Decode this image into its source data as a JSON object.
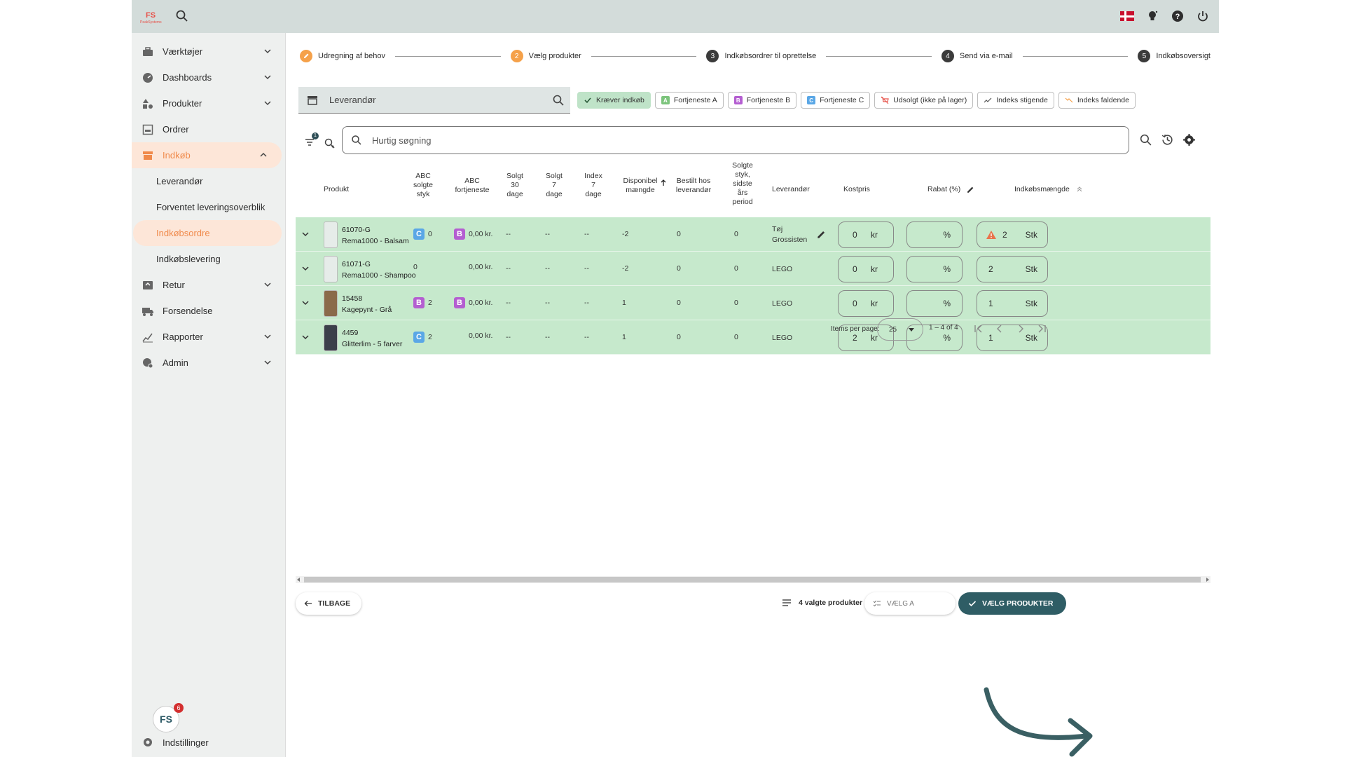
{
  "sidebar": {
    "items": [
      {
        "label": "Værktøjer",
        "icon": "toolbox-icon",
        "expandable": true
      },
      {
        "label": "Dashboards",
        "icon": "dashboard-icon",
        "expandable": true
      },
      {
        "label": "Produkter",
        "icon": "shapes-icon",
        "expandable": true
      },
      {
        "label": "Ordrer",
        "icon": "inbox-icon",
        "expandable": false
      },
      {
        "label": "Indkøb",
        "icon": "store-icon",
        "expandable": true,
        "active": true
      }
    ],
    "subitems": [
      {
        "label": "Leverandør"
      },
      {
        "label": "Forventet leveringsoverblik"
      },
      {
        "label": "Indkøbsordre",
        "active": true
      },
      {
        "label": "Indkøbslevering"
      }
    ],
    "items_after": [
      {
        "label": "Retur",
        "icon": "return-icon",
        "expandable": true
      },
      {
        "label": "Forsendelse",
        "icon": "truck-icon",
        "expandable": false
      },
      {
        "label": "Rapporter",
        "icon": "report-icon",
        "expandable": true
      },
      {
        "label": "Admin",
        "icon": "admin-icon",
        "expandable": true
      }
    ],
    "notification_count": "6",
    "settings_label": "Indstillinger"
  },
  "stepper": [
    {
      "num": "",
      "label": "Udregning af behov",
      "state": "done"
    },
    {
      "num": "2",
      "label": "Vælg produkter",
      "state": "current"
    },
    {
      "num": "3",
      "label": "Indkøbsordrer til oprettelse",
      "state": "todo"
    },
    {
      "num": "4",
      "label": "Send via e-mail",
      "state": "todo"
    },
    {
      "num": "5",
      "label": "Indkøbsoversigt",
      "state": "todo"
    }
  ],
  "vendor_field": {
    "label": "Leverandør"
  },
  "chips": [
    {
      "label": "Kræver indkøb",
      "selected": true,
      "icon": "check"
    },
    {
      "label": "Fortjeneste A",
      "selected": false,
      "icon": "A",
      "color": "#7cc47c"
    },
    {
      "label": "Fortjeneste B",
      "selected": false,
      "icon": "B",
      "color": "#b45ed1"
    },
    {
      "label": "Fortjeneste C",
      "selected": false,
      "icon": "C",
      "color": "#5aa7e6"
    },
    {
      "label": "Udsolgt (ikke på lager)",
      "selected": false,
      "icon": "cart"
    },
    {
      "label": "Indeks stigende",
      "selected": false,
      "icon": "trend-up"
    },
    {
      "label": "Indeks faldende",
      "selected": false,
      "icon": "trend-down"
    }
  ],
  "quick_search": {
    "placeholder": "Hurtig søgning",
    "filter_count": "1"
  },
  "columns": {
    "product": "Produkt",
    "abc_units": [
      "ABC",
      "solgte",
      "styk"
    ],
    "abc_profit": [
      "ABC",
      "fortjeneste"
    ],
    "sold30": [
      "Solgt",
      "30",
      "dage"
    ],
    "sold7": [
      "Solgt",
      "7",
      "dage"
    ],
    "index7": [
      "Index",
      "7",
      "dage"
    ],
    "available": [
      "Disponibel",
      "mængde"
    ],
    "ordered": [
      "Bestilt hos",
      "leverandør"
    ],
    "sold_last_year": [
      "Solgte",
      "styk,",
      "sidste",
      "års",
      "period"
    ],
    "supplier": "Leverandør",
    "cost": "Kostpris",
    "discount": "Rabat (%)",
    "qty": "Indkøbsmængde"
  },
  "rows": [
    {
      "sku": "61070-G",
      "name": "Rema1000 - Balsam",
      "abc_units_badge": "C",
      "abc_units": "0",
      "abc_profit_badge": "B",
      "abc_profit": "0,00 kr.",
      "sold30": "--",
      "sold7": "--",
      "index7": "--",
      "available": "-2",
      "ordered": "0",
      "sold_last_year": "0",
      "supplier": [
        "Tøj",
        "Grossisten"
      ],
      "supplier_editable": true,
      "cost": "0",
      "cost_unit": "kr",
      "discount": "",
      "discount_unit": "%",
      "qty": "2",
      "qty_unit": "Stk",
      "warning": true
    },
    {
      "sku": "61071-G",
      "name": "Rema1000 - Shampoo",
      "abc_units_badge": "",
      "abc_units": "0",
      "abc_profit_badge": "",
      "abc_profit": "0,00 kr.",
      "sold30": "--",
      "sold7": "--",
      "index7": "--",
      "available": "-2",
      "ordered": "0",
      "sold_last_year": "0",
      "supplier": [
        "LEGO"
      ],
      "supplier_editable": false,
      "cost": "0",
      "cost_unit": "kr",
      "discount": "",
      "discount_unit": "%",
      "qty": "2",
      "qty_unit": "Stk",
      "warning": false
    },
    {
      "sku": "15458",
      "name": "Kagepynt - Grå",
      "abc_units_badge": "B",
      "abc_units": "2",
      "abc_profit_badge": "B",
      "abc_profit": "0,00 kr.",
      "sold30": "--",
      "sold7": "--",
      "index7": "--",
      "available": "1",
      "ordered": "0",
      "sold_last_year": "0",
      "supplier": [
        "LEGO"
      ],
      "supplier_editable": false,
      "cost": "0",
      "cost_unit": "kr",
      "discount": "",
      "discount_unit": "%",
      "qty": "1",
      "qty_unit": "Stk",
      "warning": false
    },
    {
      "sku": "4459",
      "name": "Glitterlim - 5 farver",
      "abc_units_badge": "C",
      "abc_units": "2",
      "abc_profit_badge": "",
      "abc_profit": "0,00 kr.",
      "sold30": "--",
      "sold7": "--",
      "index7": "--",
      "available": "1",
      "ordered": "0",
      "sold_last_year": "0",
      "supplier": [
        "LEGO"
      ],
      "supplier_editable": false,
      "cost": "2",
      "cost_unit": "kr",
      "discount": "",
      "discount_unit": "%",
      "qty": "1",
      "qty_unit": "Stk",
      "warning": false
    }
  ],
  "pager": {
    "label": "Items per page:",
    "per_page": "25",
    "range": "1 – 4 of 4"
  },
  "footer": {
    "back": "TILBAGE",
    "selected": "4 valgte produkter",
    "mid": "VÆLG A",
    "primary": "VÆLG PRODUKTER"
  },
  "colors": {
    "accent": "#f08a4b",
    "primary": "#2f5d65",
    "row_bg": "#c6e9cc",
    "topbar": "#d3dcda"
  }
}
